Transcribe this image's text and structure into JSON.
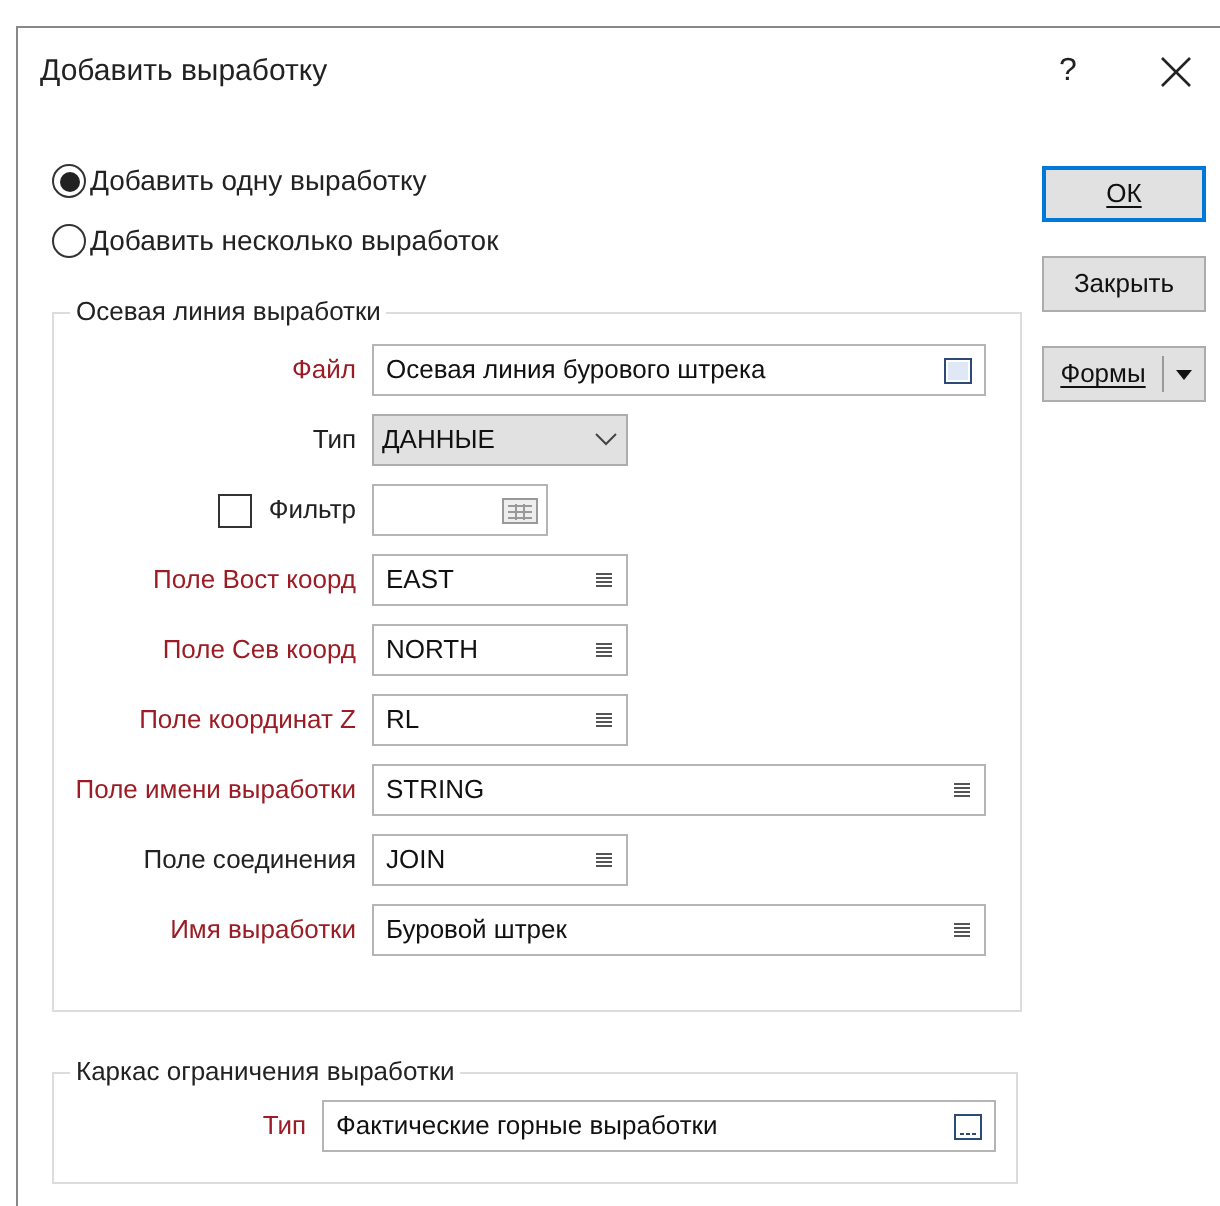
{
  "window": {
    "title": "Добавить выработку",
    "help": "?"
  },
  "modes": [
    {
      "label": "Добавить одну выработку",
      "selected": true
    },
    {
      "label": "Добавить несколько выработок",
      "selected": false
    }
  ],
  "centerline": {
    "title": "Осевая линия выработки",
    "rows": [
      {
        "kind": "file",
        "label": "Файл",
        "required": true,
        "value": "Осевая линия бурового штрека",
        "wide": true
      },
      {
        "kind": "select",
        "label": "Тип",
        "required": false,
        "value": "ДАННЫЕ"
      },
      {
        "kind": "filter",
        "label": "Фильтр",
        "required": false,
        "checked": false
      },
      {
        "kind": "field",
        "label": "Поле Вост коорд",
        "required": true,
        "value": "EAST",
        "wide": false
      },
      {
        "kind": "field",
        "label": "Поле Сев коорд",
        "required": true,
        "value": "NORTH",
        "wide": false
      },
      {
        "kind": "field",
        "label": "Поле координат Z",
        "required": true,
        "value": "RL",
        "wide": false
      },
      {
        "kind": "field",
        "label": "Поле имени выработки",
        "required": true,
        "value": "STRING",
        "wide": true
      },
      {
        "kind": "field",
        "label": "Поле соединения",
        "required": false,
        "value": "JOIN",
        "wide": false
      },
      {
        "kind": "field",
        "label": "Имя выработки",
        "required": true,
        "value": "Буровой штрек",
        "wide": true
      }
    ]
  },
  "wireframe": {
    "title": "Каркас ограничения выработки",
    "rows": [
      {
        "kind": "file2",
        "label": "Тип",
        "required": true,
        "value": "Фактические горные выработки",
        "wide": true
      }
    ]
  },
  "buttons": [
    {
      "label": "ОК",
      "kind": "default"
    },
    {
      "label": "Закрыть",
      "kind": "plain"
    },
    {
      "label": "Формы",
      "kind": "split"
    }
  ]
}
